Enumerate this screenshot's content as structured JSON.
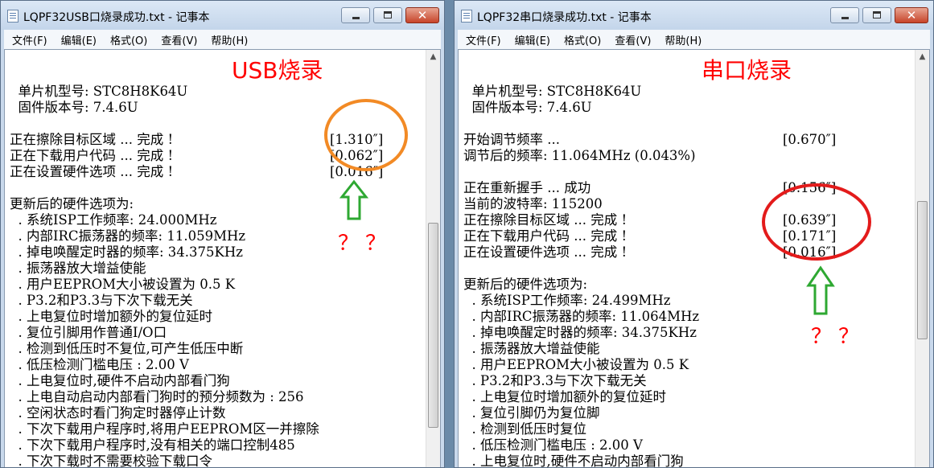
{
  "left_window": {
    "title": "LQPF32USB口烧录成功.txt - 记事本",
    "menu": [
      "文件(F)",
      "编辑(E)",
      "格式(O)",
      "查看(V)",
      "帮助(H)"
    ],
    "close_glyph": "✕",
    "lines": [
      "",
      "  单片机型号: STC8H8K64U",
      "  固件版本号: 7.4.6U",
      "",
      "正在擦除目标区域 ... 完成 !",
      "正在下载用户代码 ... 完成 !",
      "正在设置硬件选项 ... 完成 !",
      "",
      "更新后的硬件选项为:",
      "  . 系统ISP工作频率: 24.000MHz",
      "  . 内部IRC振荡器的频率: 11.059MHz",
      "  . 掉电唤醒定时器的频率: 34.375KHz",
      "  . 振荡器放大增益使能",
      "  . 用户EEPROM大小被设置为 0.5 K",
      "  . P3.2和P3.3与下次下载无关",
      "  . 上电复位时增加额外的复位延时",
      "  . 复位引脚用作普通I/O口",
      "  . 检测到低压时不复位,可产生低压中断",
      "  . 低压检测门槛电压 : 2.00 V",
      "  . 上电复位时,硬件不启动内部看门狗",
      "  . 上电自动启动内部看门狗时的预分频数为 : 256",
      "  . 空闲状态时看门狗定时器停止计数",
      "  . 下次下载用户程序时,将用户EEPROM区一并擦除",
      "  . 下次下载用户程序时,没有相关的端口控制485",
      "  . 下次下载时不需要校验下载口令"
    ],
    "timings": [
      {
        "row": 4,
        "text": "[1.310″]"
      },
      {
        "row": 5,
        "text": "[0.062″]"
      },
      {
        "row": 6,
        "text": "[0.016″]"
      }
    ],
    "annotation_heading": "USB烧录",
    "annotation_question": "？？"
  },
  "right_window": {
    "title": "LQPF32串口烧录成功.txt - 记事本",
    "menu": [
      "文件(F)",
      "编辑(E)",
      "格式(O)",
      "查看(V)",
      "帮助(H)"
    ],
    "close_glyph": "✕",
    "lines": [
      "",
      "  单片机型号: STC8H8K64U",
      "  固件版本号: 7.4.6U",
      "",
      "开始调节频率 ...",
      "调节后的频率: 11.064MHz (0.043%)",
      "",
      "正在重新握手 ... 成功",
      "当前的波特率: 115200",
      "正在擦除目标区域 ... 完成 !",
      "正在下载用户代码 ... 完成 !",
      "正在设置硬件选项 ... 完成 !",
      "",
      "更新后的硬件选项为:",
      "  . 系统ISP工作频率: 24.499MHz",
      "  . 内部IRC振荡器的频率: 11.064MHz",
      "  . 掉电唤醒定时器的频率: 34.375KHz",
      "  . 振荡器放大增益使能",
      "  . 用户EEPROM大小被设置为 0.5 K",
      "  . P3.2和P3.3与下次下载无关",
      "  . 上电复位时增加额外的复位延时",
      "  . 复位引脚仍为复位脚",
      "  . 检测到低压时复位",
      "  . 低压检测门槛电压 : 2.00 V",
      "  . 上电复位时,硬件不启动内部看门狗"
    ],
    "timings": [
      {
        "row": 4,
        "text": "[0.670″]"
      },
      {
        "row": 7,
        "text": "[0.156″]"
      },
      {
        "row": 9,
        "text": "[0.639″]"
      },
      {
        "row": 10,
        "text": "[0.171″]"
      },
      {
        "row": 11,
        "text": "[0.016″]"
      }
    ],
    "annotation_heading": "串口烧录",
    "annotation_question": "？？"
  },
  "colors": {
    "annotation_red": "#ff0000",
    "circle_orange": "#f28a25",
    "circle_red": "#e31b1b",
    "arrow_green": "#2ea832"
  }
}
